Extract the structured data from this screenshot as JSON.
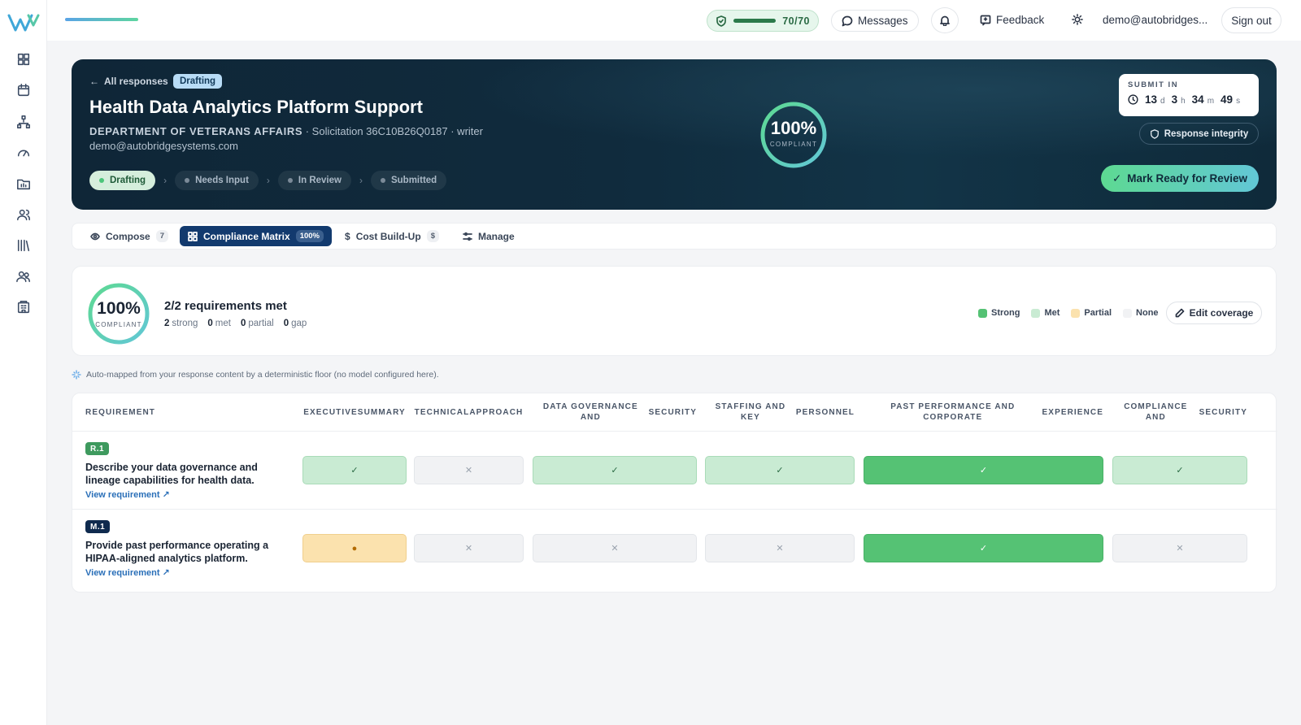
{
  "topbar": {
    "score": "70/70",
    "messages_label": "Messages",
    "feedback_label": "Feedback",
    "user_email": "demo@autobridges...",
    "signout_label": "Sign out"
  },
  "hero": {
    "back_label": "All responses",
    "status_badge": "Drafting",
    "title": "Health Data Analytics Platform Support",
    "department": "DEPARTMENT OF VETERANS AFFAIRS",
    "solicitation": " · Solicitation 36C10B26Q0187 · writer",
    "email": "demo@autobridgesystems.com",
    "stages": [
      "Drafting",
      "Needs Input",
      "In Review",
      "Submitted"
    ],
    "compliance_pct": "100%",
    "compliance_label": "COMPLIANT",
    "submit_label": "SUBMIT IN",
    "countdown": {
      "d": "13",
      "d_unit": "d",
      "h": "3",
      "h_unit": "h",
      "m": "34",
      "m_unit": "m",
      "s": "49",
      "s_unit": "s"
    },
    "integrity_label": "Response integrity",
    "mark_ready_label": "Mark Ready for Review"
  },
  "tabs": [
    {
      "label": "Compose",
      "count": "7"
    },
    {
      "label": "Compliance Matrix",
      "count": "100%"
    },
    {
      "label": "Cost Build-Up",
      "count": "$"
    },
    {
      "label": "Manage",
      "count": ""
    }
  ],
  "summary": {
    "pct": "100%",
    "pct_label": "COMPLIANT",
    "met_text": "2/2 requirements met",
    "strong_n": "2",
    "strong_label": "strong",
    "met_n": "0",
    "met_label": "met",
    "partial_n": "0",
    "partial_label": "partial",
    "gap_n": "0",
    "gap_label": "gap",
    "legend": [
      "Strong",
      "Met",
      "Partial",
      "None"
    ],
    "edit_label": "Edit coverage"
  },
  "automap_note": "Auto-mapped from your response content by a deterministic floor (no model configured here).",
  "matrix": {
    "req_header": "REQUIREMENT",
    "columns": [
      [
        "EXECUTIVE",
        "SUMMARY"
      ],
      [
        "TECHNICAL",
        "APPROACH"
      ],
      [
        "DATA GOVERNANCE AND",
        "SECURITY"
      ],
      [
        "STAFFING AND KEY",
        "PERSONNEL"
      ],
      [
        "PAST PERFORMANCE AND CORPORATE",
        "EXPERIENCE"
      ],
      [
        "COMPLIANCE AND",
        "SECURITY"
      ]
    ],
    "rows": [
      {
        "code": "R.1",
        "text": "Describe your data governance and lineage capabilities for health data.",
        "link": "View requirement ↗",
        "cells": [
          "met",
          "none",
          "met",
          "met",
          "strong",
          "met"
        ]
      },
      {
        "code": "M.1",
        "text": "Provide past performance operating a HIPAA-aligned analytics platform.",
        "link": "View requirement ↗",
        "cells": [
          "partial",
          "none",
          "none",
          "none",
          "strong",
          "none"
        ]
      }
    ]
  },
  "colors": {
    "strong": "#55c274",
    "met": "#c9ebd3",
    "partial": "#fbe2ae",
    "none": "#f1f2f4",
    "r_code": "#3e9a5e",
    "m_code": "#0f2a4e"
  }
}
